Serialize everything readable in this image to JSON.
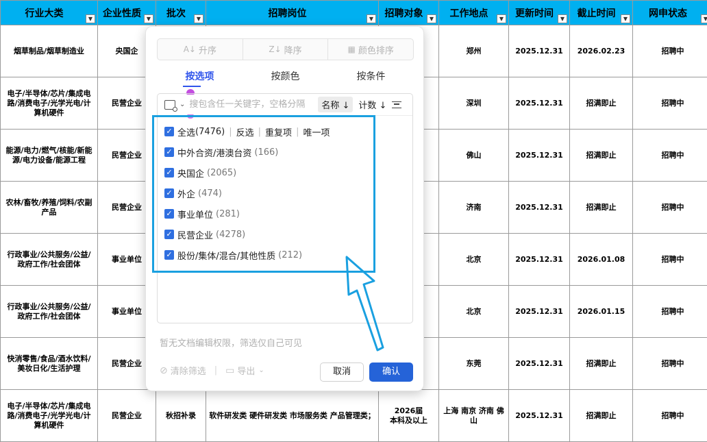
{
  "sheet": {
    "headers": [
      "行业大类",
      "企业性质",
      "批次",
      "招聘岗位",
      "招聘对象",
      "工作地点",
      "更新时间",
      "截止时间",
      "网申状态"
    ],
    "rows": [
      {
        "industry": "烟草制品/烟草制造业",
        "nature": "央国企",
        "batch": "",
        "position": "",
        "target": "6届\n上",
        "location": "郑州",
        "updated": "2025.12.31",
        "deadline": "2026.02.23",
        "status": "招聘中"
      },
      {
        "industry": "电子/半导体/芯片/集成电路/消费电子/光学光电/计算机硬件",
        "nature": "民营企业",
        "batch": "",
        "position": "",
        "target": "上",
        "location": "深圳",
        "updated": "2025.12.31",
        "deadline": "招满即止",
        "status": "招聘中"
      },
      {
        "industry": "能源/电力/燃气/核能/新能源/电力设备/能源工程",
        "nature": "民营企业",
        "batch": "",
        "position": "",
        "target": "上",
        "location": "佛山",
        "updated": "2025.12.31",
        "deadline": "招满即止",
        "status": "招聘中"
      },
      {
        "industry": "农林/畜牧/养殖/饲料/农副产品",
        "nature": "民营企业",
        "batch": "",
        "position": "",
        "target": "上",
        "location": "济南",
        "updated": "2025.12.31",
        "deadline": "招满即止",
        "status": "招聘中"
      },
      {
        "industry": "行政事业/公共服务/公益/政府工作/社会团体",
        "nature": "事业单位",
        "batch": "",
        "position": "",
        "target": "6届\n上",
        "location": "北京",
        "updated": "2025.12.31",
        "deadline": "2026.01.08",
        "status": "招聘中"
      },
      {
        "industry": "行政事业/公共服务/公益/政府工作/社会团体",
        "nature": "事业单位",
        "batch": "",
        "position": "",
        "target": "6届\n上",
        "location": "北京",
        "updated": "2025.12.31",
        "deadline": "2026.01.15",
        "status": "招聘中"
      },
      {
        "industry": "快消零售/食品/酒水饮料/美妆日化/生活护理",
        "nature": "民营企业",
        "batch": "",
        "position": "",
        "target": "上",
        "location": "东莞",
        "updated": "2025.12.31",
        "deadline": "招满即止",
        "status": "招聘中"
      },
      {
        "industry": "电子/半导体/芯片/集成电路/消费电子/光学光电/计算机硬件",
        "nature": "民营企业",
        "batch": "秋招补录",
        "position": "软件研发类 硬件研发类 市场服务类 产品管理类；",
        "target": "2026届\n本科及以上",
        "location": "上海 南京 济南 佛山",
        "updated": "2025.12.31",
        "deadline": "招满即止",
        "status": "招聘中"
      }
    ]
  },
  "filter_popup": {
    "sort_buttons": {
      "asc": "升序",
      "desc": "降序",
      "color": "颜色排序"
    },
    "tabs": [
      "按选项",
      "按颜色",
      "按条件"
    ],
    "active_tab": 0,
    "search_placeholder": "搜包含任一关键字，空格分隔",
    "name_sort": "名称 ↓",
    "count_sort": "计数 ↓",
    "select_all": {
      "label": "全选",
      "count": "(7476)"
    },
    "quick_actions": [
      "反选",
      "重复项",
      "唯一项"
    ],
    "options": [
      {
        "label": "中外合资/港澳台资",
        "count": "(166)",
        "checked": true
      },
      {
        "label": "央国企",
        "count": "(2065)",
        "checked": true
      },
      {
        "label": "外企",
        "count": "(474)",
        "checked": true
      },
      {
        "label": "事业单位",
        "count": "(281)",
        "checked": true
      },
      {
        "label": "民营企业",
        "count": "(4278)",
        "checked": true
      },
      {
        "label": "股份/集体/混合/其他性质",
        "count": "(212)",
        "checked": true
      }
    ],
    "hint": "暂无文档编辑权限，筛选仅自己可见",
    "clear_filter": "清除筛选",
    "export": "导出",
    "cancel": "取消",
    "confirm": "确认"
  },
  "colors": {
    "header_bg": "#00b0f0",
    "status_green": "#92d050",
    "accent_blue": "#2563d8",
    "highlight": "#1aa0e0"
  }
}
